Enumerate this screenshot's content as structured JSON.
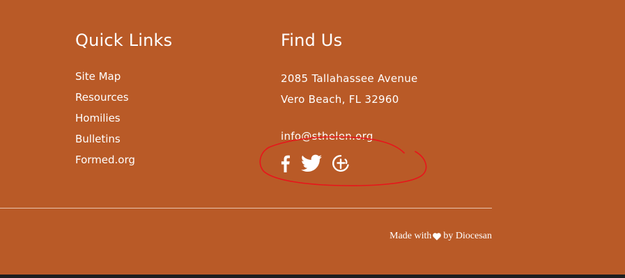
{
  "quick_links": {
    "title": "Quick Links",
    "items": [
      {
        "label": "Site Map"
      },
      {
        "label": "Resources"
      },
      {
        "label": "Homilies"
      },
      {
        "label": "Bulletins"
      },
      {
        "label": "Formed.org"
      }
    ]
  },
  "find_us": {
    "title": "Find Us",
    "address_line1": "2085 Tallahassee Avenue",
    "address_line2": "Vero Beach, FL 32960",
    "email": "info@sthelen.org"
  },
  "social": {
    "icons": [
      "facebook-icon",
      "twitter-icon",
      "diocesan-cross-icon"
    ]
  },
  "footer": {
    "made_with": "Made with",
    "by_text": "by Diocesan"
  },
  "colors": {
    "background": "#b95a27",
    "text": "#ffffff",
    "annotation": "#e8141b",
    "bottom_bar": "#1e1e1e"
  }
}
